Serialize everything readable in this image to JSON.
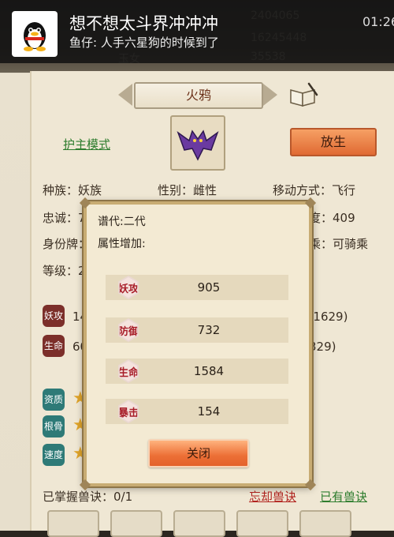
{
  "notification": {
    "title": "想不想太斗界冲冲冲",
    "message": "鱼仔: 人手六星狗的时候到了",
    "time": "01:26",
    "app_icon": "qq-penguin-icon"
  },
  "background_header": {
    "ghost_values": [
      "2404065",
      "16245448",
      "35538"
    ],
    "ghost_label": "玉女"
  },
  "pet": {
    "name": "火鸦",
    "guard_mode_label": "护主模式",
    "release_label": "放生",
    "race_label": "种族：妖族",
    "gender_label": "性别：雌性",
    "move_label": "移动方式：飞行",
    "loyalty_label": "忠诚：7",
    "speed_tail": "度：409",
    "identity_label": "身份牌：",
    "ride_tail": "乘：可骑乘",
    "level_label": "等级：2",
    "attack_hex": "妖攻",
    "attack_partial": "14",
    "attack_range_tail": "-1629)",
    "life_hex": "生命",
    "life_partial": "60",
    "life_range_tail": "329)",
    "aptitude_hex": "资质",
    "root_hex": "根骨",
    "speed_hex": "速度",
    "skills_label": "已掌握兽诀：0/1",
    "forget_skill_label": "忘却兽诀",
    "owned_skill_label": "已有兽诀"
  },
  "dialog": {
    "generation": "谱代:二代",
    "attr_bonus_label": "属性增加:",
    "attributes": [
      {
        "label": "妖攻",
        "value": "905"
      },
      {
        "label": "防御",
        "value": "732"
      },
      {
        "label": "生命",
        "value": "1584"
      },
      {
        "label": "暴击",
        "value": "154"
      }
    ],
    "close_label": "关闭"
  },
  "colors": {
    "accent_orange": "#ec6f36",
    "link_green": "#2e7d2e",
    "link_red": "#b2241f"
  }
}
